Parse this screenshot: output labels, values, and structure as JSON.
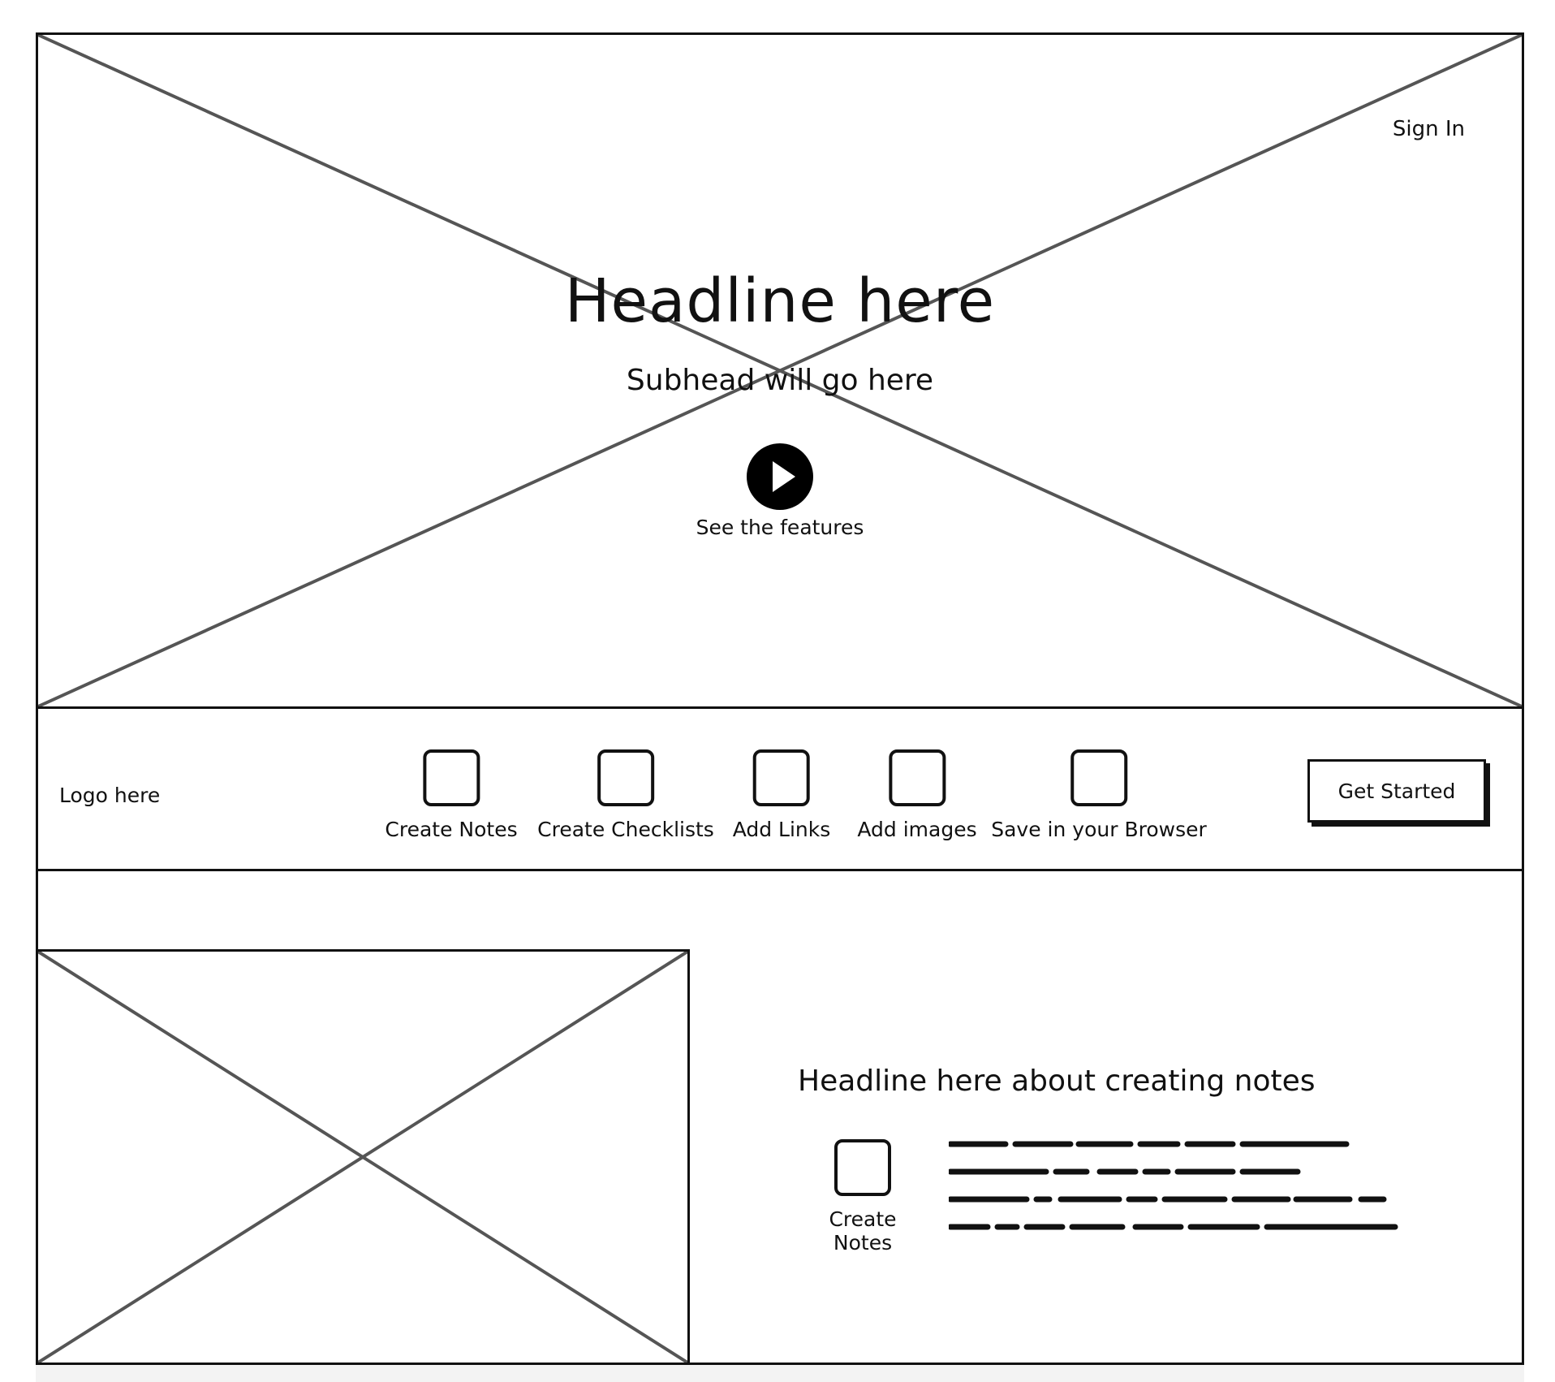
{
  "hero": {
    "headline": "Headline here",
    "subhead": "Subhead will go here",
    "play_caption": "See the features",
    "sign_in_label": "Sign In"
  },
  "navbar": {
    "logo": "Logo here",
    "features": [
      {
        "label": "Create Notes",
        "icon": "square-icon"
      },
      {
        "label": "Create Checklists",
        "icon": "square-icon"
      },
      {
        "label": "Add Links",
        "icon": "square-icon"
      },
      {
        "label": "Add images",
        "icon": "square-icon"
      },
      {
        "label": "Save in your Browser",
        "icon": "square-icon"
      }
    ],
    "cta_label": "Get Started"
  },
  "section2": {
    "headline": "Headline here about creating notes",
    "feature_label": "Create Notes"
  },
  "colors": {
    "line": "#111111",
    "placeholder_cross": "#555555",
    "background": "#ffffff"
  }
}
